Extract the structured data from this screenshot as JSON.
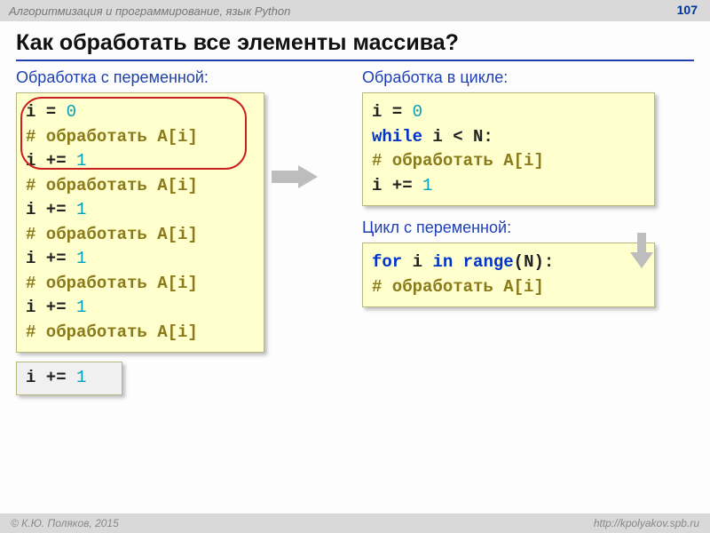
{
  "header": {
    "course": "Алгоритмизация и программирование, язык Python",
    "page": "107"
  },
  "title": "Как обработать все элементы массива?",
  "left": {
    "subhead": "Обработка с переменной:",
    "code": [
      {
        "t": "plain",
        "v": "i"
      },
      {
        "t": "plain",
        "v": " = "
      },
      {
        "t": "num",
        "v": "0"
      },
      {
        "br": true
      },
      {
        "t": "comment",
        "v": "# обработать A[i]"
      },
      {
        "br": true
      },
      {
        "t": "plain",
        "v": "i"
      },
      {
        "t": "plain",
        "v": " += "
      },
      {
        "t": "num",
        "v": "1"
      },
      {
        "br": true
      },
      {
        "t": "comment",
        "v": "# обработать A[i]"
      },
      {
        "br": true
      },
      {
        "t": "plain",
        "v": "i"
      },
      {
        "t": "plain",
        "v": " += "
      },
      {
        "t": "num",
        "v": "1"
      },
      {
        "br": true
      },
      {
        "t": "comment",
        "v": "# обработать A[i]"
      },
      {
        "br": true
      },
      {
        "t": "plain",
        "v": "i"
      },
      {
        "t": "plain",
        "v": " += "
      },
      {
        "t": "num",
        "v": "1"
      },
      {
        "br": true
      },
      {
        "t": "comment",
        "v": "# обработать A[i]"
      },
      {
        "br": true
      },
      {
        "t": "plain",
        "v": "i"
      },
      {
        "t": "plain",
        "v": " += "
      },
      {
        "t": "num",
        "v": "1"
      },
      {
        "br": true
      },
      {
        "t": "comment",
        "v": "# обработать A[i]"
      }
    ],
    "extra": [
      {
        "t": "plain",
        "v": "i"
      },
      {
        "t": "plain",
        "v": " += "
      },
      {
        "t": "num",
        "v": "1"
      }
    ]
  },
  "right": {
    "subhead1": "Обработка в цикле:",
    "code1": [
      {
        "t": "plain",
        "v": "i"
      },
      {
        "t": "plain",
        "v": " = "
      },
      {
        "t": "num",
        "v": "0"
      },
      {
        "br": true
      },
      {
        "t": "kw-blue",
        "v": "while"
      },
      {
        "t": "plain",
        "v": "  i < N:"
      },
      {
        "br": true
      },
      {
        "t": "plain",
        "v": "   "
      },
      {
        "t": "comment",
        "v": "# обработать A[i]"
      },
      {
        "br": true
      },
      {
        "t": "plain",
        "v": "   i"
      },
      {
        "t": "plain",
        "v": " += "
      },
      {
        "t": "num",
        "v": "1"
      }
    ],
    "subhead2": "Цикл с переменной:",
    "code2": [
      {
        "t": "kw-blue",
        "v": "for"
      },
      {
        "t": "plain",
        "v": " i "
      },
      {
        "t": "kw-blue",
        "v": "in"
      },
      {
        "t": "plain",
        "v": " "
      },
      {
        "t": "kw-blue",
        "v": "range"
      },
      {
        "t": "plain",
        "v": "(N):"
      },
      {
        "br": true
      },
      {
        "t": "plain",
        "v": "   "
      },
      {
        "t": "comment",
        "v": "# обработать A[i]"
      }
    ]
  },
  "footer": {
    "left": "© К.Ю. Поляков, 2015",
    "right": "http://kpolyakov.spb.ru"
  }
}
